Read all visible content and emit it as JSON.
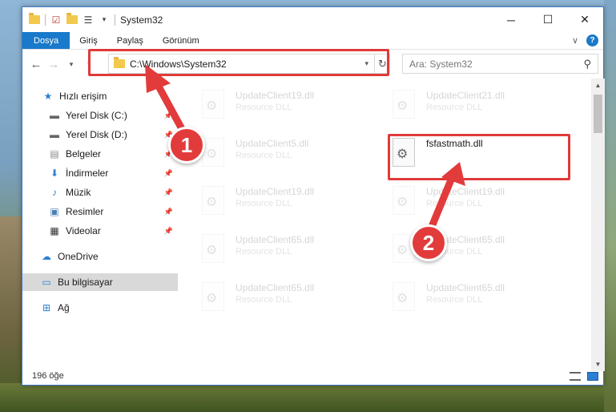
{
  "window": {
    "title": "System32",
    "minimize_glyph": "─",
    "maximize_glyph": "☐",
    "close_glyph": "✕"
  },
  "ribbon": {
    "tabs": [
      "Dosya",
      "Giriş",
      "Paylaş",
      "Görünüm"
    ],
    "expand_glyph": "∨",
    "help_glyph": "?"
  },
  "address": {
    "path": "C:\\Windows\\System32",
    "search_placeholder": "Ara: System32"
  },
  "nav": {
    "items": [
      {
        "label": "Hızlı erişim",
        "icon": "star-icon"
      },
      {
        "label": "Yerel Disk (C:)",
        "icon": "drive-icon"
      },
      {
        "label": "Yerel Disk (D:)",
        "icon": "drive-icon"
      },
      {
        "label": "Belgeler",
        "icon": "documents-icon"
      },
      {
        "label": "İndirmeler",
        "icon": "download-icon"
      },
      {
        "label": "Müzik",
        "icon": "music-icon"
      },
      {
        "label": "Resimler",
        "icon": "pictures-icon"
      },
      {
        "label": "Videolar",
        "icon": "video-icon"
      },
      {
        "label": "OneDrive",
        "icon": "cloud-icon"
      },
      {
        "label": "Bu bilgisayar",
        "icon": "computer-icon"
      },
      {
        "label": "Ağ",
        "icon": "network-icon"
      }
    ]
  },
  "files": [
    {
      "name": "UpdateClient19.dll",
      "type": "Resource DLL"
    },
    {
      "name": "UpdateClient21.dll",
      "type": "Resource DLL"
    },
    {
      "name": "UpdateClient5.dll",
      "type": "Resource DLL"
    },
    {
      "name": "fsfastmath.dll",
      "type": ""
    },
    {
      "name": "UpdateClient19.dll",
      "type": "Resource DLL"
    },
    {
      "name": "UpdateClient19.dll",
      "type": "Resource DLL"
    },
    {
      "name": "UpdateClient65.dll",
      "type": "Resource DLL"
    },
    {
      "name": "UpdateClient65.dll",
      "type": "Resource DLL"
    },
    {
      "name": "UpdateClient65.dll",
      "type": "Resource DLL"
    },
    {
      "name": "UpdateClient65.dll",
      "type": "Resource DLL"
    }
  ],
  "status": {
    "count": "196 öğe"
  },
  "callouts": {
    "one": "1",
    "two": "2"
  },
  "colors": {
    "accent": "#1979ca",
    "highlight": "#e03a3a"
  }
}
